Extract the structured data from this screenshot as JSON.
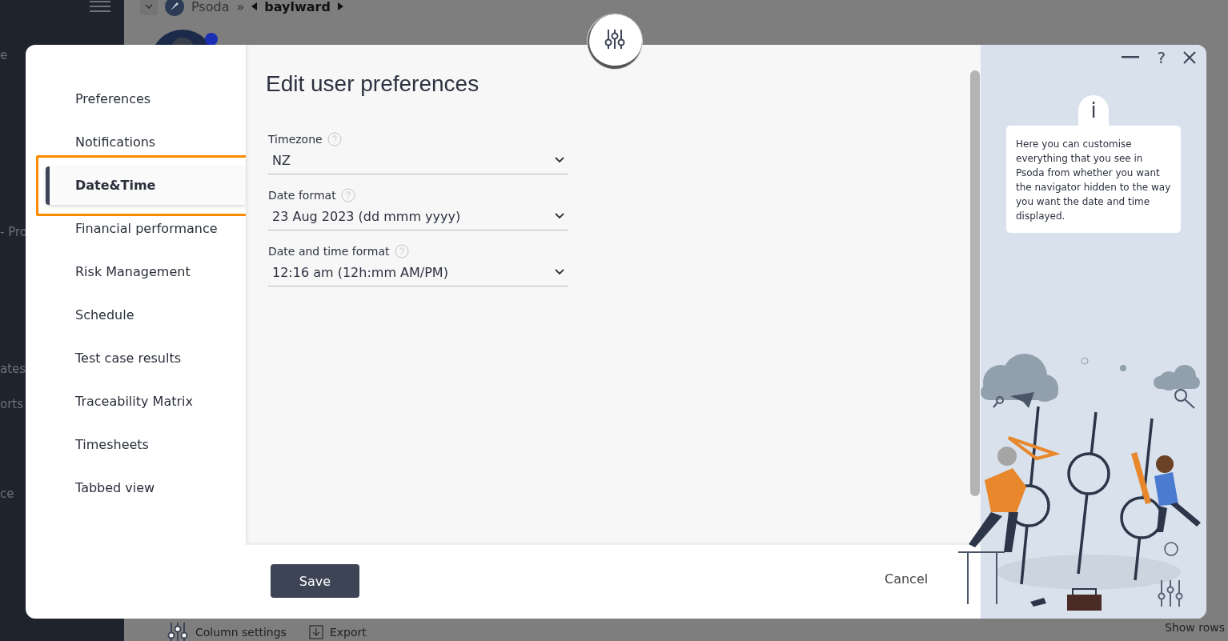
{
  "background": {
    "breadcrumb": {
      "home": "Psoda",
      "separator": "»",
      "current": "baylward"
    },
    "sidebar_fragments": [
      "e",
      "- Pro",
      "ates",
      "orts",
      "ce"
    ],
    "toolbar": [
      "Column settings",
      "Export"
    ],
    "footer_text": "Show rows"
  },
  "dialog": {
    "nav_items": [
      {
        "label": "Preferences",
        "selected": false,
        "highlighted": false
      },
      {
        "label": "Notifications",
        "selected": false,
        "highlighted": false
      },
      {
        "label": "Date&Time",
        "selected": true,
        "highlighted": true
      },
      {
        "label": "Financial performance",
        "selected": false,
        "highlighted": false
      },
      {
        "label": "Risk Management",
        "selected": false,
        "highlighted": false
      },
      {
        "label": "Schedule",
        "selected": false,
        "highlighted": false
      },
      {
        "label": "Test case results",
        "selected": false,
        "highlighted": false
      },
      {
        "label": "Traceability Matrix",
        "selected": false,
        "highlighted": false
      },
      {
        "label": "Timesheets",
        "selected": false,
        "highlighted": false
      },
      {
        "label": "Tabbed view",
        "selected": false,
        "highlighted": false
      }
    ],
    "title": "Edit user preferences",
    "fields": [
      {
        "label": "Timezone",
        "value": "NZ"
      },
      {
        "label": "Date format",
        "value": "23 Aug 2023 (dd mmm yyyy)"
      },
      {
        "label": "Date and time format",
        "value": "12:16 am (12h:mm AM/PM)"
      }
    ],
    "save": "Save",
    "cancel": "Cancel",
    "help": "?",
    "info": {
      "mark": "i",
      "text": "Here you can customise everything that you see in Psoda from whether you want the navigator hidden to the way you want the date and time displayed."
    }
  }
}
